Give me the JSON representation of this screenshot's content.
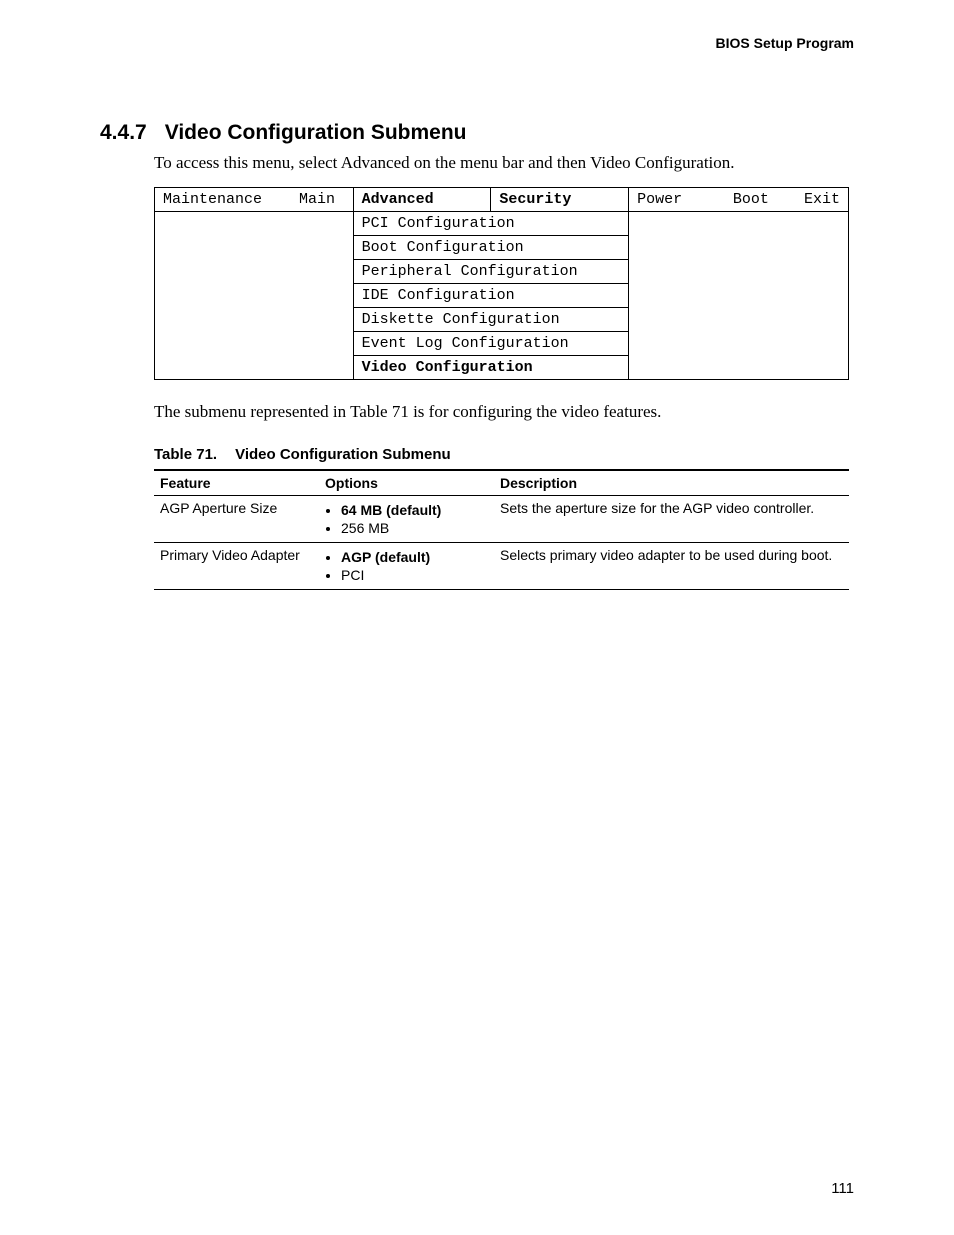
{
  "header": {
    "running": "BIOS Setup Program"
  },
  "section": {
    "number": "4.4.7",
    "title": "Video Configuration Submenu",
    "intro": "To access this menu, select Advanced on the menu bar and then Video Configuration."
  },
  "bios": {
    "tabs": {
      "maintenance": "Maintenance",
      "main": "Main",
      "advanced": "Advanced",
      "security": "Security",
      "power": "Power",
      "boot": "Boot",
      "exit": "Exit"
    },
    "submenus": {
      "pci": "PCI Configuration",
      "bootcfg": "Boot Configuration",
      "periph": "Peripheral Configuration",
      "ide": "IDE Configuration",
      "diskette": "Diskette Configuration",
      "eventlog": "Event Log Configuration",
      "video": "Video Configuration"
    }
  },
  "post_intro": "The submenu represented in Table 71 is for configuring the video features.",
  "table": {
    "caption_num": "Table 71.",
    "caption_title": "Video Configuration Submenu",
    "headers": {
      "feature": "Feature",
      "options": "Options",
      "description": "Description"
    },
    "rows": [
      {
        "feature": "AGP Aperture Size",
        "options": {
          "opt1": "64 MB (default)",
          "opt2": "256 MB"
        },
        "opt1_bold": true,
        "description": "Sets the aperture size for the AGP video controller."
      },
      {
        "feature": "Primary Video Adapter",
        "options": {
          "opt1": "AGP (default)",
          "opt2": "PCI"
        },
        "opt1_bold": true,
        "description": "Selects primary video adapter to be used during boot."
      }
    ]
  },
  "page_number": "111"
}
